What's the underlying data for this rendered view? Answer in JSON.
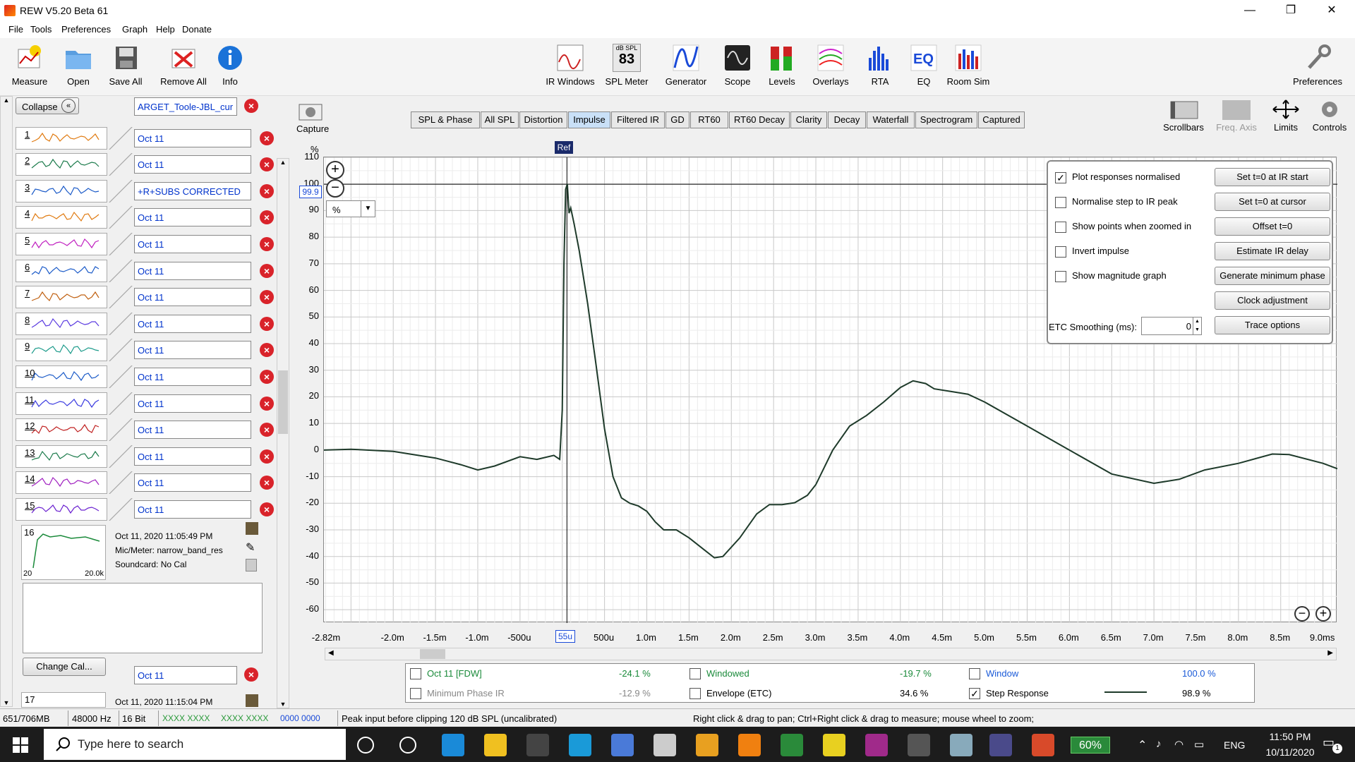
{
  "window": {
    "title": "REW V5.20 Beta 61",
    "minimize": "—",
    "maximize": "❐",
    "close": "✕"
  },
  "menu": [
    "File",
    "Tools",
    "Preferences",
    "Graph",
    "Help",
    "Donate"
  ],
  "toolbar_left": [
    "Measure",
    "Open",
    "Save All",
    "Remove All",
    "Info"
  ],
  "toolbar_center": [
    "IR Windows",
    "SPL Meter",
    "Generator",
    "Scope",
    "Levels",
    "Overlays",
    "RTA",
    "EQ",
    "Room Sim"
  ],
  "toolbar_right": "Preferences",
  "spl_meter": {
    "unit": "dB SPL",
    "value": "83"
  },
  "left": {
    "collapse": "Collapse",
    "top_name": "ARGET_Toole-JBL_cur",
    "slots": [
      {
        "n": "1",
        "name": "Oct 11",
        "color": "#e07a10"
      },
      {
        "n": "2",
        "name": "Oct 11",
        "color": "#1a7a4a"
      },
      {
        "n": "3",
        "name": "+R+SUBS CORRECTED",
        "color": "#1a5ac8"
      },
      {
        "n": "4",
        "name": "Oct 11",
        "color": "#e07a10"
      },
      {
        "n": "5",
        "name": "Oct 11",
        "color": "#c020c0"
      },
      {
        "n": "6",
        "name": "Oct 11",
        "color": "#1a5ac8"
      },
      {
        "n": "7",
        "name": "Oct 11",
        "color": "#c06010"
      },
      {
        "n": "8",
        "name": "Oct 11",
        "color": "#5a3ae0"
      },
      {
        "n": "9",
        "name": "Oct 11",
        "color": "#1a9a8a"
      },
      {
        "n": "10",
        "name": "Oct 11",
        "color": "#1a5ac8"
      },
      {
        "n": "11",
        "name": "Oct 11",
        "color": "#3a3ae0"
      },
      {
        "n": "12",
        "name": "Oct 11",
        "color": "#c02020"
      },
      {
        "n": "13",
        "name": "Oct 11",
        "color": "#1a7a4a"
      },
      {
        "n": "14",
        "name": "Oct 11",
        "color": "#a020c0"
      },
      {
        "n": "15",
        "name": "Oct 11",
        "color": "#6a20d0"
      }
    ],
    "selected": {
      "n": "16",
      "date": "Oct 11, 2020 11:05:49 PM",
      "mic": "Mic/Meter: narrow_band_res",
      "soundcard": "Soundcard: No Cal",
      "fmin": "20",
      "fmax": "20.0k"
    },
    "change_cal": "Change Cal...",
    "slot17_name": "Oct 11",
    "slot17_n": "17",
    "slot17_date": "Oct 11, 2020 11:15:04 PM"
  },
  "capture": "Capture",
  "tabs": [
    "SPL & Phase",
    "All SPL",
    "Distortion",
    "Impulse",
    "Filtered IR",
    "GD",
    "RT60",
    "RT60 Decay",
    "Clarity",
    "Decay",
    "Waterfall",
    "Spectrogram",
    "Captured"
  ],
  "active_tab": "Impulse",
  "right_tools": [
    "Scrollbars",
    "Freq. Axis",
    "Limits",
    "Controls"
  ],
  "plot": {
    "y_unit": "%",
    "y_unit_select": "%",
    "cursor_value": "99.9",
    "ref_label": "Ref",
    "cursor_x_label": "55u",
    "y_ticks": [
      "110",
      "100",
      "90",
      "80",
      "70",
      "60",
      "50",
      "40",
      "30",
      "20",
      "10",
      "0",
      "-10",
      "-20",
      "-30",
      "-40",
      "-50",
      "-60"
    ],
    "x_ticks": [
      "-2.82m",
      "-2.0m",
      "-1.5m",
      "-1.0m",
      "-500u",
      "500u",
      "1.0m",
      "1.5m",
      "2.0m",
      "2.5m",
      "3.0m",
      "3.5m",
      "4.0m",
      "4.5m",
      "5.0m",
      "5.5m",
      "6.0m",
      "6.5m",
      "7.0m",
      "7.5m",
      "8.0m",
      "8.5m",
      "9.0ms"
    ],
    "trace_color": "#1e3a2a"
  },
  "options": {
    "checks": [
      {
        "label": "Plot responses normalised",
        "checked": true
      },
      {
        "label": "Normalise step to IR peak",
        "checked": false
      },
      {
        "label": "Show points when zoomed in",
        "checked": false
      },
      {
        "label": "Invert impulse",
        "checked": false
      },
      {
        "label": "Show magnitude graph",
        "checked": false
      }
    ],
    "buttons": [
      "Set t=0 at IR start",
      "Set t=0 at cursor",
      "Offset t=0",
      "Estimate IR delay",
      "Generate minimum phase",
      "Clock adjustment",
      "Trace options"
    ],
    "etc_label": "ETC Smoothing (ms):",
    "etc_value": "0"
  },
  "legend": [
    {
      "label": "Oct 11 [FDW]",
      "value": "-24.1 %",
      "color": "#1a8a3a"
    },
    {
      "label": "Minimum Phase IR",
      "value": "-12.9 %",
      "color": "#888888"
    },
    {
      "label": "Windowed",
      "value": "-19.7 %",
      "color": "#1a8a3a"
    },
    {
      "label": "Envelope (ETC)",
      "value": "34.6 %",
      "color": "#000000"
    },
    {
      "label": "Window",
      "value": "100.0 %",
      "color": "#1a5ad8"
    },
    {
      "label": "Step Response",
      "value": "98.9 %",
      "color": "#000000"
    }
  ],
  "status": {
    "memory": "651/706MB",
    "rate": "48000 Hz",
    "bits": "16 Bit",
    "peak": "Peak input before clipping 120 dB SPL (uncalibrated)",
    "hint": "Right click & drag to pan; Ctrl+Right click & drag to measure; mouse wheel to zoom;",
    "levels_a": "XXXX XXXX",
    "levels_b": "XXXX XXXX",
    "levels_c": "0000 0000"
  },
  "taskbar": {
    "search": "Type here to search",
    "battery": "60%",
    "lang": "ENG",
    "time": "11:50 PM",
    "date": "10/11/2020",
    "notif": "1"
  }
}
